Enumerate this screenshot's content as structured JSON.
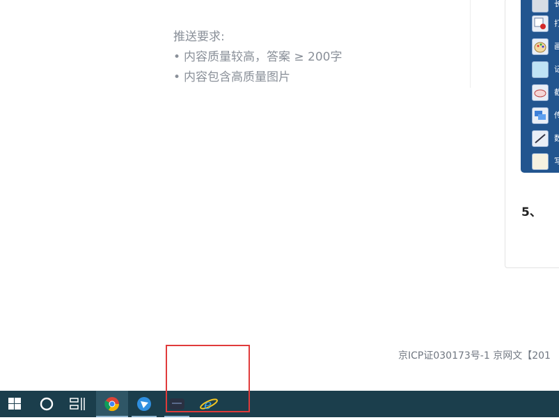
{
  "push_requirements": {
    "title": "推送要求:",
    "items": [
      "内容质量较高，答案 ≥ 200字",
      "内容包含高质量图片"
    ]
  },
  "side_panel": {
    "menu_labels": [
      "长",
      "打",
      "画",
      "记",
      "截",
      "传",
      "数",
      "写"
    ],
    "step_label": "5、"
  },
  "footer": {
    "icp_text": "京ICP证030173号-1   京网文【201"
  },
  "taskbar": {
    "items": [
      {
        "icon": "windows-start-icon"
      },
      {
        "icon": "cortana-search-icon"
      },
      {
        "icon": "task-view-icon"
      },
      {
        "icon": "chrome-icon"
      },
      {
        "icon": "feishu-icon"
      },
      {
        "icon": "dark-app-icon"
      },
      {
        "icon": "internet-explorer-icon"
      }
    ]
  },
  "colors": {
    "taskbar_bg": "#1b3e4c",
    "highlight_box": "#e03a3a",
    "menu_panel": "#22558f",
    "muted_text": "#8a9099"
  }
}
